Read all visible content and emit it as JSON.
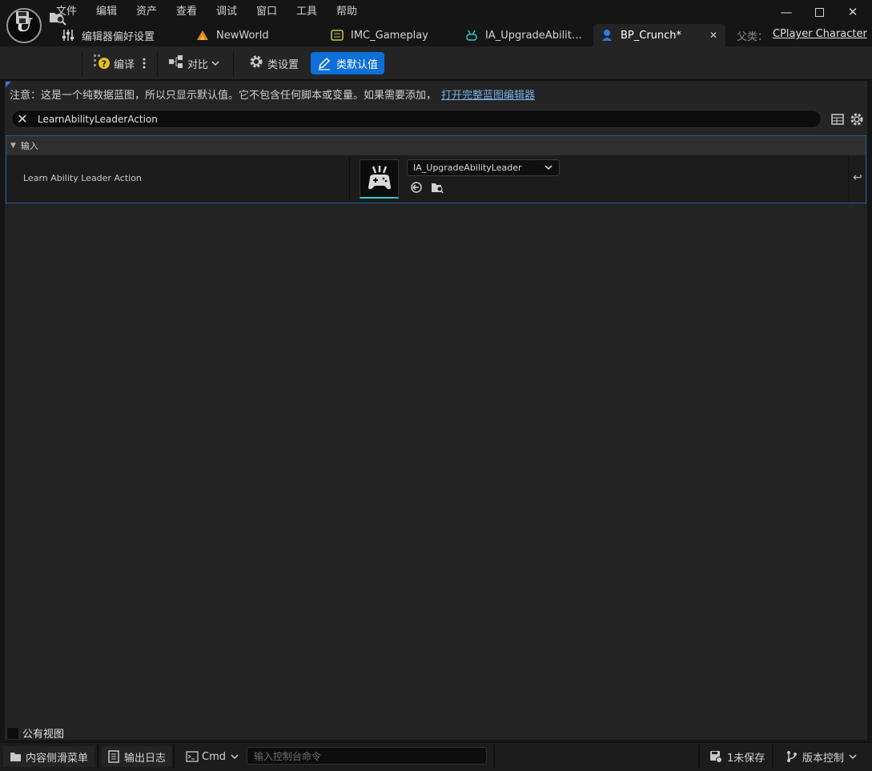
{
  "menu": [
    "文件",
    "编辑",
    "资产",
    "查看",
    "调试",
    "窗口",
    "工具",
    "帮助"
  ],
  "tabs": [
    {
      "label": "编辑器偏好设置",
      "icon": "sliders-icon"
    },
    {
      "label": "NewWorld",
      "icon": "level-icon"
    },
    {
      "label": "IMC_Gameplay",
      "icon": "input-mapping-icon"
    },
    {
      "label": "IA_UpgradeAbilit…",
      "icon": "input-action-icon"
    },
    {
      "label": "BP_Crunch*",
      "icon": "blueprint-pawn-icon",
      "active": true
    }
  ],
  "parent": {
    "label": "父类：",
    "value": "CPlayer Character"
  },
  "toolbar": {
    "compile": "编译",
    "diff": "对比",
    "class_settings": "类设置",
    "class_defaults": "类默认值"
  },
  "notice": {
    "text": "注意：这是一个纯数据蓝图，所以只显示默认值。它不包含任何脚本或变量。如果需要添加，",
    "link": "打开完整蓝图编辑器"
  },
  "search": {
    "value": "LearnAbilityLeaderAction"
  },
  "category": {
    "label": "输入"
  },
  "property": {
    "name": "Learn Ability Leader Action",
    "asset": "IA_UpgradeAbilityLeader"
  },
  "public_view": "公有视图",
  "statusbar": {
    "content_drawer": "内容侧滑菜单",
    "output_log": "输出日志",
    "cmd": "Cmd",
    "console_placeholder": "输入控制台命令",
    "unsaved": "1未保存",
    "source_control": "版本控制"
  },
  "colors": {
    "accent": "#0e6fd8",
    "panel": "#242424",
    "link": "#74aee6"
  }
}
